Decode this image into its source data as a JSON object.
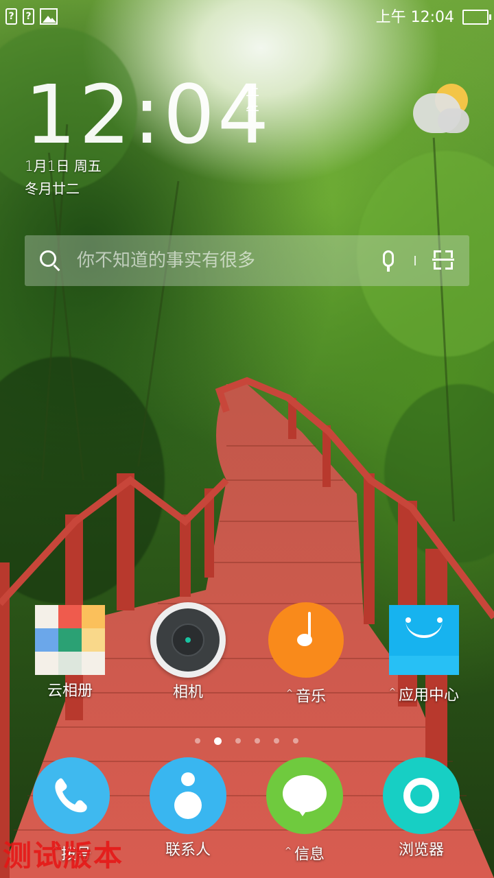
{
  "status_bar": {
    "notif_1": "?",
    "notif_2": "?",
    "time": "上午 12:04"
  },
  "clock": {
    "time": "12:04",
    "ampm": "上午",
    "date": "1月1日 周五",
    "lunar": "冬月廿二"
  },
  "weather": {
    "icon": "partly-cloudy-icon"
  },
  "search": {
    "placeholder": "你不知道的事实有很多",
    "icons": [
      "search-icon",
      "mic-icon",
      "scan-icon"
    ]
  },
  "apps": [
    {
      "label": "云相册",
      "has_caret": false,
      "icon": "gallery-icon"
    },
    {
      "label": "相机",
      "has_caret": false,
      "icon": "camera-icon"
    },
    {
      "label": "音乐",
      "has_caret": true,
      "icon": "music-icon"
    },
    {
      "label": "应用中心",
      "has_caret": true,
      "icon": "app-store-icon"
    }
  ],
  "dock": [
    {
      "label": "拨号",
      "has_caret": true,
      "icon": "phone-icon",
      "color": "#3fb9ef"
    },
    {
      "label": "联系人",
      "has_caret": false,
      "icon": "contacts-icon",
      "color": "#39b6f0"
    },
    {
      "label": "信息",
      "has_caret": true,
      "icon": "message-icon",
      "color": "#6fca3e"
    },
    {
      "label": "浏览器",
      "has_caret": false,
      "icon": "browser-icon",
      "color": "#17cfc4"
    }
  ],
  "pager": {
    "pages": 6,
    "active_index": 1
  },
  "watermark": "测试版本",
  "colors": {
    "gallery_tiles": [
      "#f4f0e8",
      "#ef5b4d",
      "#fbc05b",
      "#6ba7ea",
      "#2ba174",
      "#f9d88a",
      "#f4f0e8",
      "#dde7dd",
      "#f4f0e8"
    ],
    "camera": "#3b3f41",
    "music": "#f98a1b",
    "app_store": "#17b3ef"
  }
}
